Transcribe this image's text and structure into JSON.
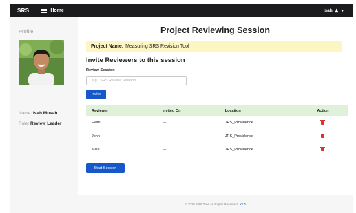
{
  "navbar": {
    "brand": "SRS",
    "home_label": "Home",
    "user_name": "Isah"
  },
  "sidebar": {
    "title": "Profile",
    "name_label": "Name:",
    "name_value": "Isah Musah",
    "role_label": "Role:",
    "role_value": "Review Leader"
  },
  "main": {
    "title": "Project Reviewing Session",
    "project_label": "Project Name:",
    "project_name": "Measuring SRS Revision Tool",
    "invite_heading": "Invite Reviewers to this session",
    "session_label": "Review Session",
    "session_placeholder": "e.g., SRS Review Session 1",
    "session_value": "",
    "invite_button": "Invite",
    "start_button": "Start Session"
  },
  "table": {
    "headers": [
      "Reviewer",
      "Invited On",
      "Location",
      "Action"
    ],
    "rows": [
      {
        "reviewer": "Evan",
        "invited_on": "---",
        "location": "JRS_Providence"
      },
      {
        "reviewer": "John",
        "invited_on": "---",
        "location": "JRS_Providence"
      },
      {
        "reviewer": "Mike",
        "invited_on": "---",
        "location": "JRS_Providence"
      }
    ]
  },
  "footer": {
    "text": "© 2024 SRS Tool. All Rights Reserved.",
    "version": "v2.0"
  },
  "icons": {
    "menu": "hamburger-menu-icon",
    "user": "user-icon",
    "caret": "caret-down-icon",
    "delete": "trash-icon"
  },
  "colors": {
    "navbar_bg": "#1c1c1e",
    "primary": "#1658c9",
    "project_bar_bg": "#fdf6c3",
    "table_header_bg": "#e0f1d9",
    "delete": "#d9342b",
    "sidebar_bg": "#f6f6f6"
  }
}
